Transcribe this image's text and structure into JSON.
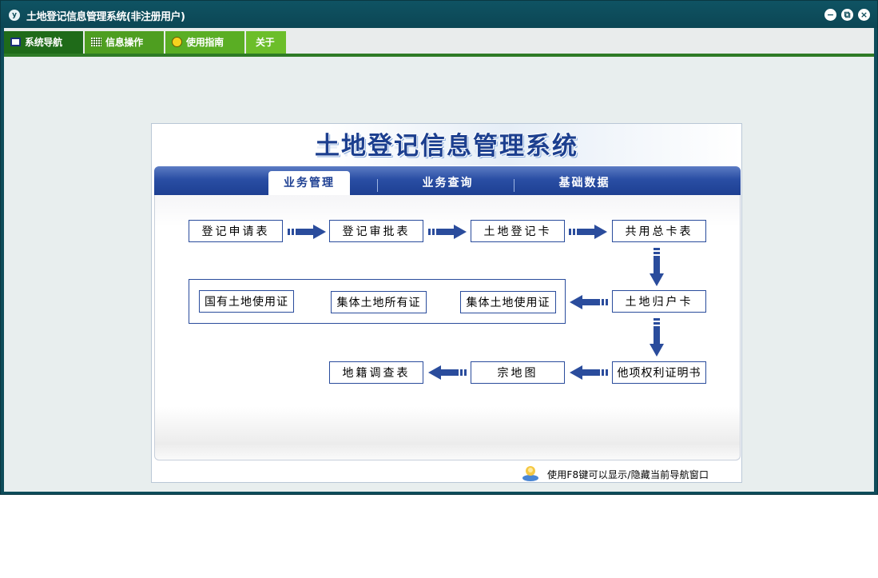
{
  "window": {
    "title": "土地登记信息管理系统(非注册用户)",
    "icon": "app-logo-icon",
    "buttons": {
      "minimize": "−",
      "restore": "⧉",
      "close": "×"
    }
  },
  "menu": {
    "items": [
      {
        "label": "系统导航",
        "icon": "monitor-icon",
        "color": "#1f6b19"
      },
      {
        "label": "信息操作",
        "icon": "grid-icon",
        "color": "#4e9e20"
      },
      {
        "label": "使用指南",
        "icon": "help-icon",
        "color": "#5aae24"
      },
      {
        "label": "关于",
        "icon": "",
        "color": "#6cbe2a"
      }
    ]
  },
  "nav": {
    "logo_title": "土地登记信息管理系统",
    "tabs": [
      {
        "label": "业务管理",
        "active": true
      },
      {
        "label": "业务查询",
        "active": false
      },
      {
        "label": "基础数据",
        "active": false
      }
    ],
    "flow": {
      "row1": [
        "登记申请表",
        "登记审批表",
        "土地登记卡",
        "共用总卡表"
      ],
      "row2_group": [
        "国有土地使用证",
        "集体土地所有证",
        "集体土地使用证"
      ],
      "row2_right": "土地归户卡",
      "row3": [
        "地籍调查表",
        "宗地图",
        "他项权利证明书"
      ]
    },
    "hint": "使用F8键可以显示/隐藏当前导航窗口"
  },
  "colors": {
    "titlebar": "#0e4c5a",
    "menu_line": "#2e7b26",
    "tabbar": "#2a4ea4",
    "flow_border": "#2a4c9c"
  }
}
